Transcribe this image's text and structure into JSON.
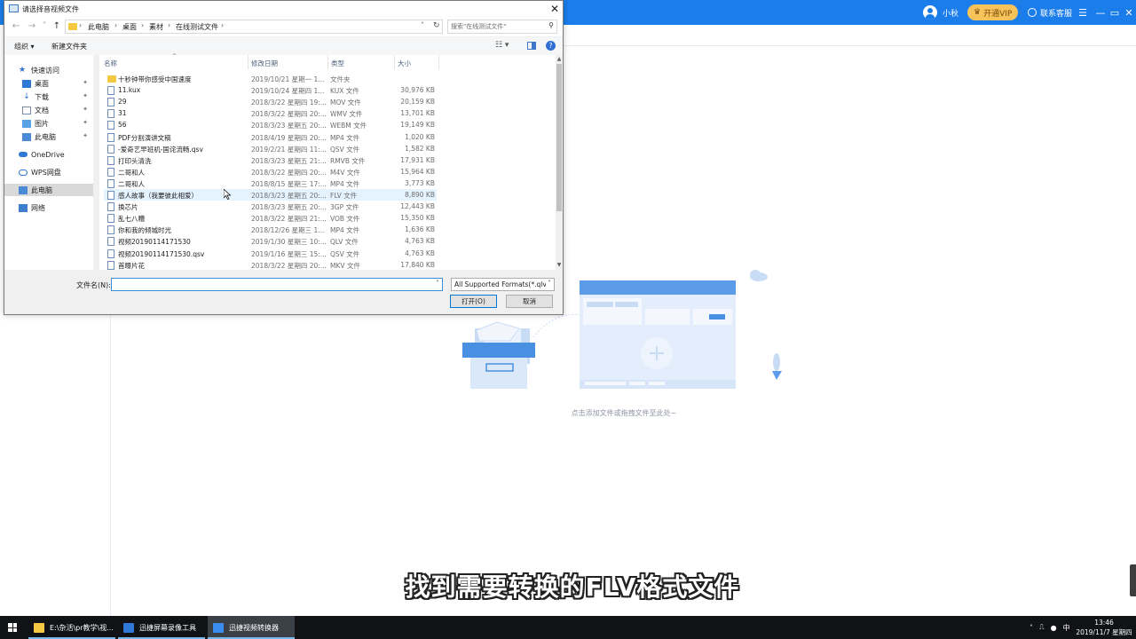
{
  "app": {
    "username": "小秋",
    "vip_label": "开通VIP",
    "service_label": "联系客服",
    "drop_hint": "点击添加文件或拖拽文件至此处~",
    "accent_color": "#1a7dea"
  },
  "subtitle": "找到需要转换的FLV格式文件",
  "dialog": {
    "title": "请选择音视频文件",
    "breadcrumbs": [
      "此电脑",
      "桌面",
      "素材",
      "在线测试文件"
    ],
    "search_placeholder": "搜索\"在线测试文件\"",
    "organize_label": "组织 ▾",
    "new_folder_label": "新建文件夹",
    "nav_items": [
      {
        "label": "快速访问",
        "icon": "star-icon"
      },
      {
        "label": "桌面",
        "icon": "desktop-icon"
      },
      {
        "label": "下载",
        "icon": "download-icon"
      },
      {
        "label": "文档",
        "icon": "document-icon"
      },
      {
        "label": "图片",
        "icon": "picture-icon"
      },
      {
        "label": "此电脑",
        "icon": "computer-icon"
      },
      {
        "label": "OneDrive",
        "icon": "cloud-icon"
      },
      {
        "label": "WPS网盘",
        "icon": "wps-cloud-icon"
      },
      {
        "label": "此电脑",
        "icon": "computer-icon"
      },
      {
        "label": "网络",
        "icon": "network-icon"
      }
    ],
    "columns": {
      "name": "名称",
      "date": "修改日期",
      "type": "类型",
      "size": "大小"
    },
    "files": [
      {
        "name": "十秒钟带你感受中国速度",
        "date": "2019/10/21 星期一 1...",
        "type": "文件夹",
        "size": "",
        "folder": true
      },
      {
        "name": "11.kux",
        "date": "2019/10/24 星期四 1...",
        "type": "KUX 文件",
        "size": "30,976 KB"
      },
      {
        "name": "29",
        "date": "2018/3/22 星期四 19:...",
        "type": "MOV 文件",
        "size": "20,159 KB"
      },
      {
        "name": "31",
        "date": "2018/3/22 星期四 20:...",
        "type": "WMV 文件",
        "size": "13,701 KB"
      },
      {
        "name": "56",
        "date": "2018/3/23 星期五 20:...",
        "type": "WEBM 文件",
        "size": "19,149 KB"
      },
      {
        "name": "PDF分割演讲文稿",
        "date": "2018/4/19 星期四 20:...",
        "type": "MP4 文件",
        "size": "1,020 KB"
      },
      {
        "name": "-爱奇艺早班机-国诧流畅.qsv",
        "date": "2019/2/21 星期四 11:...",
        "type": "QSV 文件",
        "size": "1,582 KB"
      },
      {
        "name": "打印头清洗",
        "date": "2018/3/23 星期五 21:...",
        "type": "RMVB 文件",
        "size": "17,931 KB"
      },
      {
        "name": "二哥和人",
        "date": "2018/3/22 星期四 20:...",
        "type": "M4V 文件",
        "size": "15,964 KB"
      },
      {
        "name": "二哥和人",
        "date": "2018/8/15 星期三 17:...",
        "type": "MP4 文件",
        "size": "3,773 KB"
      },
      {
        "name": "感人故事（我要彼此相爱）",
        "date": "2018/3/23 星期五 20:...",
        "type": "FLV 文件",
        "size": "8,890 KB"
      },
      {
        "name": "换芯片",
        "date": "2018/3/23 星期五 20:...",
        "type": "3GP 文件",
        "size": "12,443 KB"
      },
      {
        "name": "乱七八糟",
        "date": "2018/3/22 星期四 21:...",
        "type": "VOB 文件",
        "size": "15,350 KB"
      },
      {
        "name": "你和我的倾城时光",
        "date": "2018/12/26 星期三 1...",
        "type": "MP4 文件",
        "size": "1,636 KB"
      },
      {
        "name": "视频20190114171530",
        "date": "2019/1/30 星期三 10:...",
        "type": "QLV 文件",
        "size": "4,763 KB"
      },
      {
        "name": "视频20190114171530.qsv",
        "date": "2019/1/16 星期三 15:...",
        "type": "QSV 文件",
        "size": "4,763 KB"
      },
      {
        "name": "首曝片花",
        "date": "2018/3/22 星期四 20:...",
        "type": "MKV 文件",
        "size": "17,840 KB"
      }
    ],
    "filename_label": "文件名(N):",
    "filename_value": "",
    "filetype_value": "All Supported Formats(*.qlv;",
    "open_label": "打开(O)",
    "cancel_label": "取消"
  },
  "taskbar": {
    "tasks": [
      {
        "label": "E:\\杂活\\pr教学\\视...",
        "icon": "folder-icon"
      },
      {
        "label": "迅捷屏幕录像工具",
        "icon": "recorder-icon"
      },
      {
        "label": "迅捷视频转换器",
        "icon": "converter-icon"
      }
    ],
    "ime": "中",
    "time": "13:46",
    "date": "2019/11/7 星期四"
  }
}
